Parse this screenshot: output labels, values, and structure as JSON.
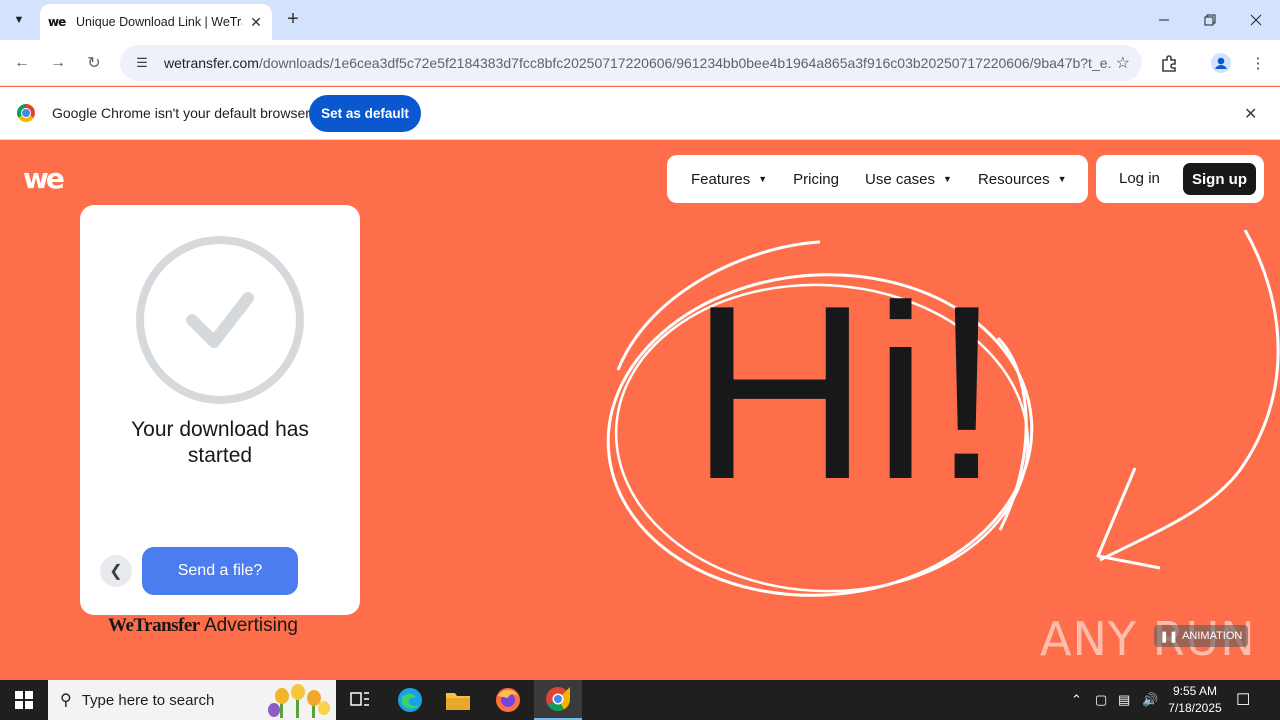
{
  "browser": {
    "tab_title": "Unique Download Link | WeTransfer",
    "tab_favicon": "we",
    "url_host": "wetransfer.com",
    "url_path": "/downloads/1e6cea3df5c72e5f2184383d7fcc8bfc20250717220606/961234bb0bee4b1964a865a3f916c03b20250717220606/9ba47b?t_e...",
    "infobar_text": "Google Chrome isn't your default browser",
    "infobar_button": "Set as default"
  },
  "site": {
    "logo": "we",
    "nav": [
      "Features",
      "Pricing",
      "Use cases",
      "Resources"
    ],
    "login": "Log in",
    "signup": "Sign up"
  },
  "card": {
    "message": "Your download has started",
    "send_button": "Send a file?"
  },
  "advertising": {
    "brand": "WeTransfer",
    "label": "Advertising"
  },
  "hero": {
    "text": "Hi!"
  },
  "overlay": {
    "watermark": "ANY RUN",
    "animation_badge": "ANIMATION"
  },
  "taskbar": {
    "search_placeholder": "Type here to search",
    "time": "9:55 AM",
    "date": "7/18/2025"
  },
  "colors": {
    "page_bg": "#ff6e4b",
    "send_button": "#4c7df0",
    "chrome_accent": "#0b57d0",
    "dark": "#17181a"
  }
}
